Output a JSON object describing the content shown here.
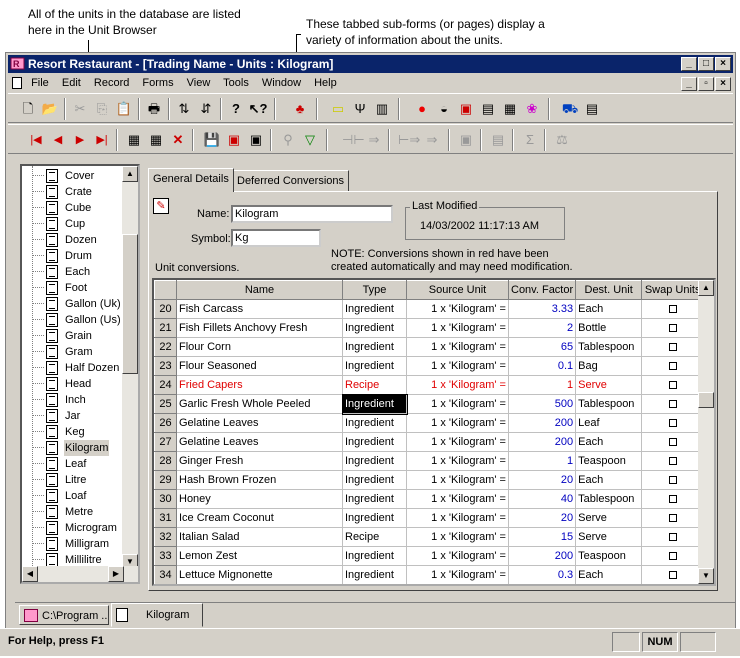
{
  "annotations": {
    "left": "All of the units in the database are listed here in the Unit Browser",
    "right": "These tabbed sub-forms (or pages) display a variety of information about the units."
  },
  "window": {
    "title": "Resort Restaurant - [Trading Name - Units : Kilogram]",
    "controls": [
      "_",
      "□",
      "X"
    ],
    "mdi_controls": [
      "_",
      "◻",
      "X"
    ]
  },
  "menu": [
    "File",
    "Edit",
    "Record",
    "Forms",
    "View",
    "Tools",
    "Window",
    "Help"
  ],
  "tree": {
    "items": [
      "Cover",
      "Crate",
      "Cube",
      "Cup",
      "Dozen",
      "Drum",
      "Each",
      "Foot",
      "Gallon (Uk)",
      "Gallon (Us)",
      "Grain",
      "Gram",
      "Half Dozen",
      "Head",
      "Inch",
      "Jar",
      "Keg",
      "Kilogram",
      "Leaf",
      "Litre",
      "Loaf",
      "Metre",
      "Microgram",
      "Milligram",
      "Millilitre"
    ],
    "selected": "Kilogram"
  },
  "tabs": [
    "General Details",
    "Deferred Conversions"
  ],
  "general": {
    "name_label": "Name:",
    "name_value": "Kilogram",
    "symbol_label": "Symbol:",
    "symbol_value": "Kg",
    "last_modified_label": "Last Modified",
    "last_modified_value": "14/03/2002 11:17:13 AM",
    "note": "NOTE: Conversions shown in red have been created automatically and may need modification.",
    "unit_conversions_label": "Unit conversions."
  },
  "grid": {
    "columns": [
      "",
      "Name",
      "Type",
      "Source Unit",
      "Conv. Factor",
      "Dest. Unit",
      "Swap Units"
    ],
    "rows": [
      {
        "n": "20",
        "name": "Fish Carcass",
        "type": "Ingredient",
        "src": "1 x 'Kilogram' =",
        "factor": "3.33",
        "dest": "Each",
        "red": false
      },
      {
        "n": "21",
        "name": "Fish Fillets Anchovy Fresh",
        "type": "Ingredient",
        "src": "1 x 'Kilogram' =",
        "factor": "2",
        "dest": "Bottle",
        "red": false
      },
      {
        "n": "22",
        "name": "Flour Corn",
        "type": "Ingredient",
        "src": "1 x 'Kilogram' =",
        "factor": "65",
        "dest": "Tablespoon",
        "red": false
      },
      {
        "n": "23",
        "name": "Flour Seasoned",
        "type": "Ingredient",
        "src": "1 x 'Kilogram' =",
        "factor": "0.1",
        "dest": "Bag",
        "red": false
      },
      {
        "n": "24",
        "name": "Fried Capers",
        "type": "Recipe",
        "src": "1 x 'Kilogram' =",
        "factor": "1",
        "dest": "Serve",
        "red": true
      },
      {
        "n": "25",
        "name": "Garlic Fresh Whole Peeled",
        "type": "Ingredient",
        "src": "1 x 'Kilogram' =",
        "factor": "500",
        "dest": "Tablespoon",
        "red": false,
        "selected": true
      },
      {
        "n": "26",
        "name": "Gelatine Leaves",
        "type": "Ingredient",
        "src": "1 x 'Kilogram' =",
        "factor": "200",
        "dest": "Leaf",
        "red": false
      },
      {
        "n": "27",
        "name": "Gelatine Leaves",
        "type": "Ingredient",
        "src": "1 x 'Kilogram' =",
        "factor": "200",
        "dest": "Each",
        "red": false
      },
      {
        "n": "28",
        "name": "Ginger Fresh",
        "type": "Ingredient",
        "src": "1 x 'Kilogram' =",
        "factor": "1",
        "dest": "Teaspoon",
        "red": false
      },
      {
        "n": "29",
        "name": "Hash Brown Frozen",
        "type": "Ingredient",
        "src": "1 x 'Kilogram' =",
        "factor": "20",
        "dest": "Each",
        "red": false
      },
      {
        "n": "30",
        "name": "Honey",
        "type": "Ingredient",
        "src": "1 x 'Kilogram' =",
        "factor": "40",
        "dest": "Tablespoon",
        "red": false
      },
      {
        "n": "31",
        "name": "Ice Cream Coconut",
        "type": "Ingredient",
        "src": "1 x 'Kilogram' =",
        "factor": "20",
        "dest": "Serve",
        "red": false
      },
      {
        "n": "32",
        "name": "Italian Salad",
        "type": "Recipe",
        "src": "1 x 'Kilogram' =",
        "factor": "15",
        "dest": "Serve",
        "red": false
      },
      {
        "n": "33",
        "name": "Lemon Zest",
        "type": "Ingredient",
        "src": "1 x 'Kilogram' =",
        "factor": "200",
        "dest": "Teaspoon",
        "red": false
      },
      {
        "n": "34",
        "name": "Lettuce Mignonette",
        "type": "Ingredient",
        "src": "1 x 'Kilogram' =",
        "factor": "0.3",
        "dest": "Each",
        "red": false
      }
    ]
  },
  "taskbar": {
    "item1": "C:\\Program ...",
    "item2": "Kilogram"
  },
  "status": {
    "help": "For Help, press F1",
    "num": "NUM"
  }
}
